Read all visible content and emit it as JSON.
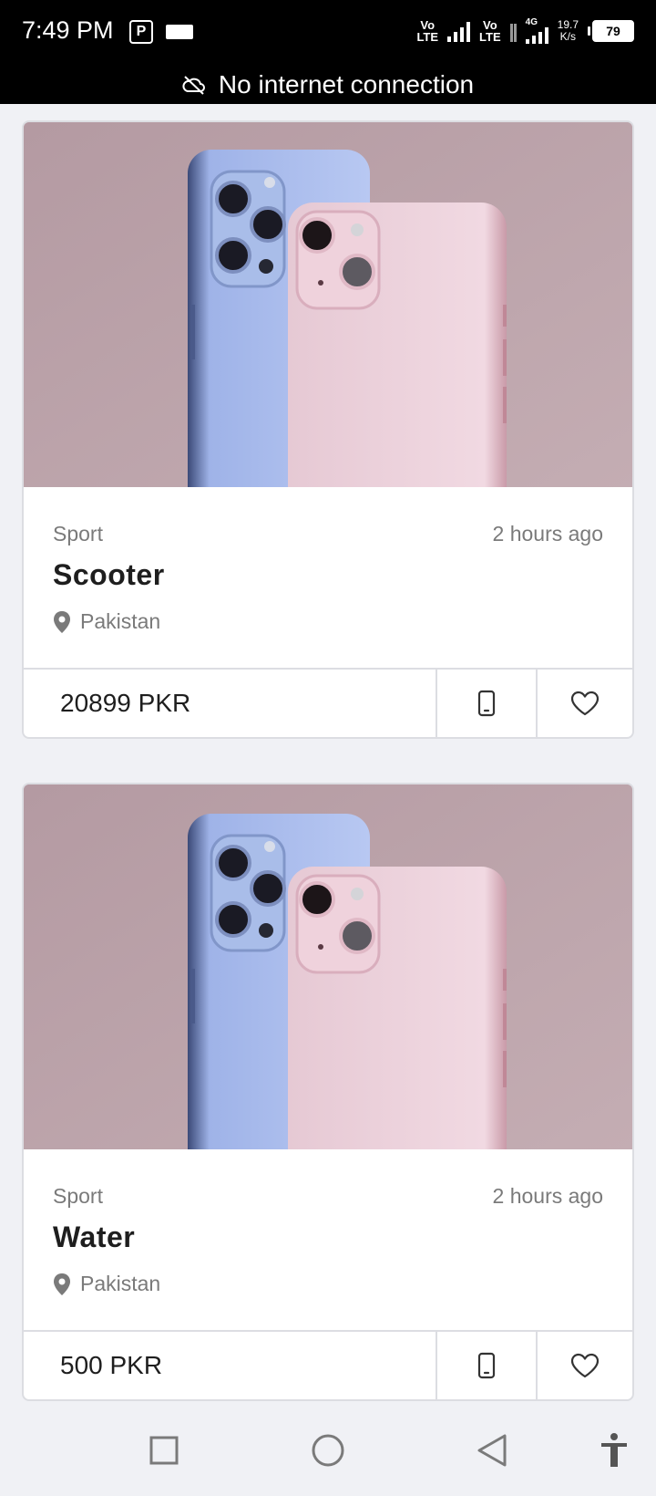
{
  "status_bar": {
    "time": "7:49 PM",
    "p_icon": "P",
    "volte_1": "Vo\nLTE",
    "volte_2": "Vo\nLTE",
    "network_type": "4G",
    "speed_value": "19.7",
    "speed_unit": "K/s",
    "battery": "79"
  },
  "offline_banner": {
    "text": "No internet connection",
    "icon": "cloud-off-icon"
  },
  "listings": [
    {
      "category": "Sport",
      "time": "2 hours ago",
      "title": "Scooter",
      "location": "Pakistan",
      "price": "20899 PKR"
    },
    {
      "category": "Sport",
      "time": "2 hours ago",
      "title": "Water",
      "location": "Pakistan",
      "price": "500 PKR"
    }
  ],
  "icons": {
    "location": "location-pin-icon",
    "phone": "phone-icon",
    "favorite": "heart-icon",
    "nav_recents": "square-icon",
    "nav_home": "circle-icon",
    "nav_back": "triangle-back-icon",
    "accessibility": "accessibility-icon"
  },
  "colors": {
    "background": "#f0f1f5",
    "status_bar": "#000000",
    "card_border": "#dcdde2",
    "muted_text": "#7a7a7a",
    "title_text": "#1e1e1e",
    "image_bg": "#b79ca4"
  }
}
